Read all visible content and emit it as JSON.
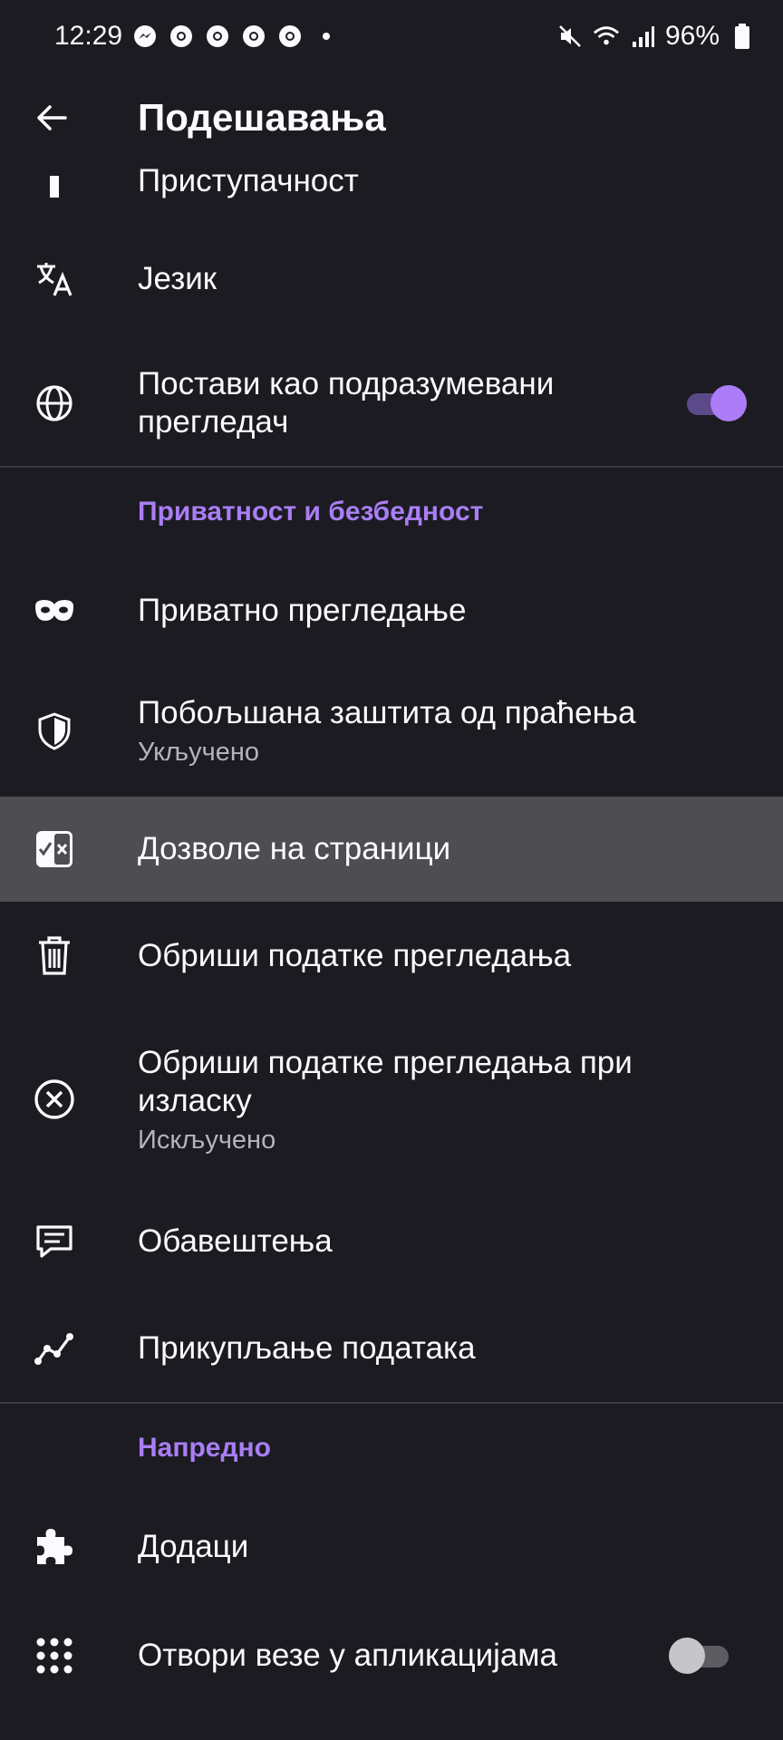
{
  "status_bar": {
    "time": "12:29",
    "battery": "96%",
    "notification_icons": [
      "messenger-icon",
      "chrome-icon",
      "chrome-icon",
      "chrome-icon",
      "chrome-icon"
    ],
    "system_icons": [
      "mute-icon",
      "wifi-icon",
      "signal-icon",
      "battery-icon"
    ]
  },
  "app_bar": {
    "title": "Подешавања"
  },
  "items": {
    "accessibility": {
      "label": "Приступачност"
    },
    "language": {
      "label": "Језик"
    },
    "default_browser": {
      "label": "Постави као подразумевани прегледач",
      "toggle": "on"
    },
    "private_browsing": {
      "label": "Приватно прегледање"
    },
    "tracking_protection": {
      "label": "Побољшана заштита од праћења",
      "sub": "Укључено"
    },
    "site_permissions": {
      "label": "Дозволе на страници"
    },
    "delete_data": {
      "label": "Обриши податке прегледања"
    },
    "delete_on_quit": {
      "label": "Обриши податке прегледања при изласку",
      "sub": "Искључено"
    },
    "notifications": {
      "label": "Обавештења"
    },
    "data_collection": {
      "label": "Прикупљање података"
    },
    "addons": {
      "label": "Додаци"
    },
    "open_links": {
      "label": "Отвори везе у апликацијама",
      "toggle": "off"
    }
  },
  "sections": {
    "privacy": "Приватност и безбедност",
    "advanced": "Напредно"
  },
  "colors": {
    "background": "#1c1b22",
    "accent": "#a97ef5",
    "highlight": "#4d4d52"
  }
}
